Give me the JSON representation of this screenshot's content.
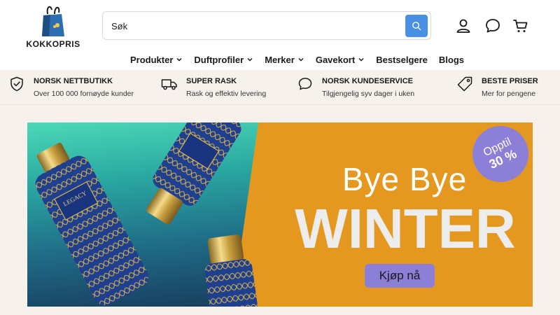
{
  "header": {
    "logo_text": "KOKKOPRIS",
    "search": {
      "placeholder": "Søk"
    },
    "icons": [
      "account-icon",
      "chat-icon",
      "cart-icon"
    ]
  },
  "nav": {
    "items": [
      {
        "label": "Produkter",
        "dropdown": true
      },
      {
        "label": "Duftprofiler",
        "dropdown": true
      },
      {
        "label": "Merker",
        "dropdown": true
      },
      {
        "label": "Gavekort",
        "dropdown": true
      },
      {
        "label": "Bestselgere",
        "dropdown": false
      },
      {
        "label": "Blogs",
        "dropdown": false
      }
    ]
  },
  "usp": [
    {
      "icon": "shield-check-icon",
      "title": "NORSK NETTBUTIKK",
      "subtitle": "Over 100 000 fornøyde kunder"
    },
    {
      "icon": "truck-icon",
      "title": "SUPER RASK",
      "subtitle": "Rask og effektiv levering"
    },
    {
      "icon": "chat-bubble-icon",
      "title": "NORSK KUNDESERVICE",
      "subtitle": "Tilgjengelig syv dager i uken"
    },
    {
      "icon": "price-tag-icon",
      "title": "BESTE PRISER",
      "subtitle": "Mer for pengene"
    }
  ],
  "banner": {
    "headline_line1": "Bye Bye",
    "headline_line2": "WINTER",
    "cta_label": "Kjøp nå",
    "badge_top": "Opptil",
    "badge_bottom": "30 %",
    "bottle_brand": "LEGACY",
    "colors": {
      "orange": "#e49820",
      "purple": "#8b7fd8",
      "teal": "#4cd9b7",
      "navy": "#1f3f8f"
    }
  }
}
